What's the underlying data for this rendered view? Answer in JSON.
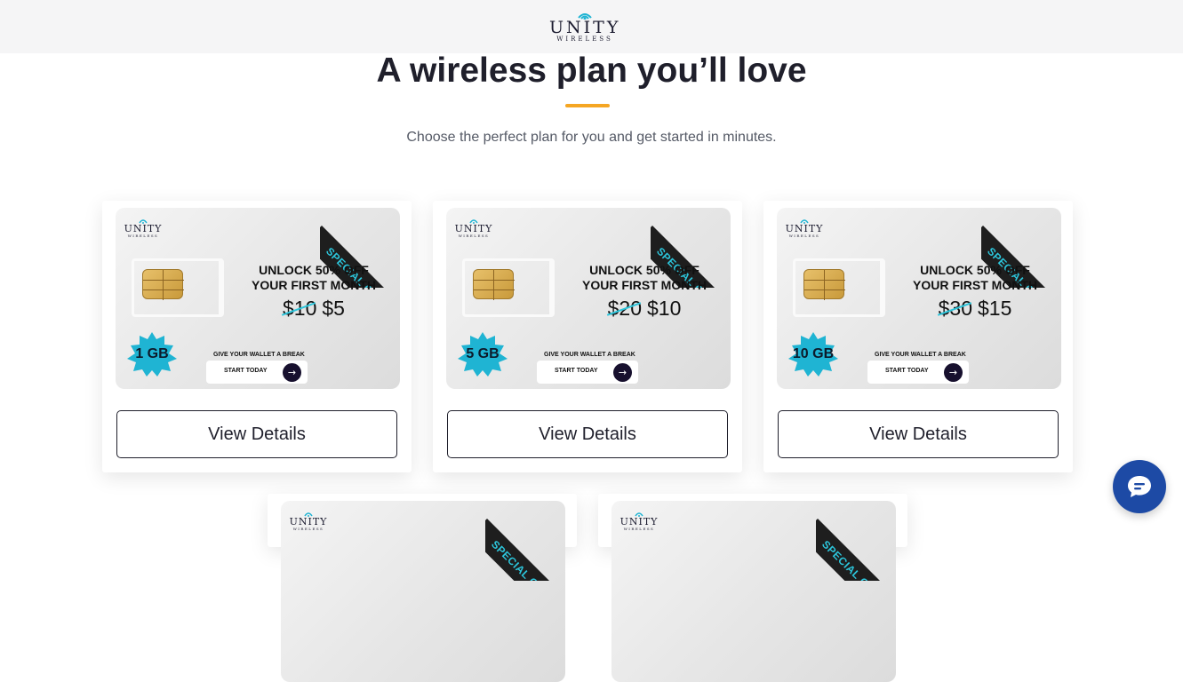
{
  "header": {
    "logo_text": "UNITY",
    "logo_sub": "WIRELESS"
  },
  "hero": {
    "title": "A wireless plan you’ll love",
    "subtitle": "Choose the perfect plan for you and get started in minutes.",
    "accent_color": "#f5a623"
  },
  "plans": [
    {
      "data": "1 GB",
      "old_price": "$10",
      "new_price": "$5"
    },
    {
      "data": "5 GB",
      "old_price": "$20",
      "new_price": "$10"
    },
    {
      "data": "10 GB",
      "old_price": "$30",
      "new_price": "$15"
    },
    {
      "data": "",
      "old_price": "",
      "new_price": ""
    },
    {
      "data": "",
      "old_price": "",
      "new_price": ""
    }
  ],
  "banner": {
    "logo_text": "UNITY",
    "logo_sub": "WIRELESS",
    "ribbon": "SPECIAL OFFER",
    "offer_line1": "UNLOCK 50% OFF",
    "offer_line2": "YOUR FIRST  MONTH",
    "wallet": "GIVE YOUR WALLET A BREAK",
    "start": "START TODAY",
    "badge_color": "#1fb4d3",
    "ribbon_text_color": "#2cc6dc"
  },
  "buttons": {
    "view_details": "View Details"
  },
  "chat": {
    "icon": "chat-bubble-icon",
    "color": "#1d4aa5"
  }
}
